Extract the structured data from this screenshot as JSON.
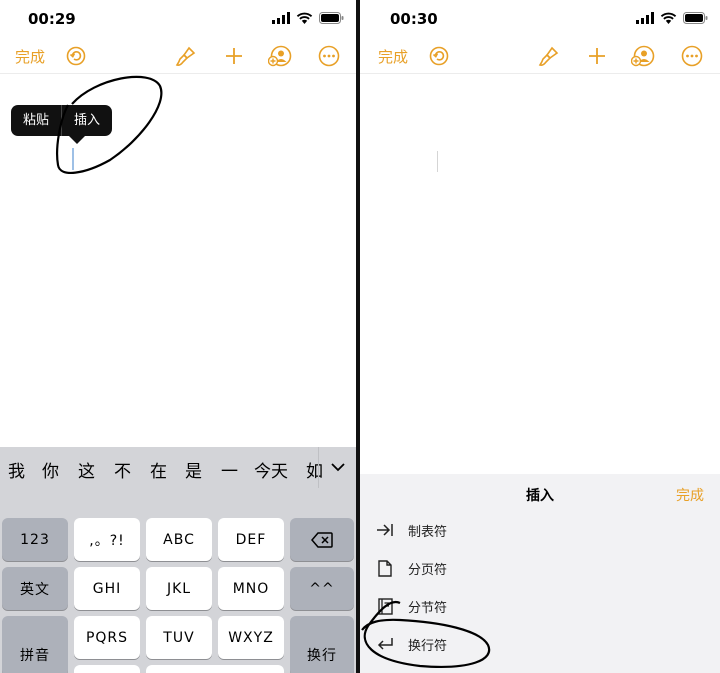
{
  "left": {
    "status": {
      "time": "00:29"
    },
    "toolbar": {
      "done_label": "完成"
    },
    "popup": {
      "paste_label": "粘贴",
      "insert_label": "插入"
    },
    "keyboard": {
      "candidates": [
        "我",
        "你",
        "这",
        "不",
        "在",
        "是",
        "一",
        "今天",
        "如"
      ],
      "keys": {
        "num": "123",
        "punct": ",。?!",
        "abc": "ABC",
        "def": "DEF",
        "eng": "英文",
        "ghi": "GHI",
        "jkl": "JKL",
        "mno": "MNO",
        "face": "^^",
        "pinyin": "拼音",
        "pqrs": "PQRS",
        "tuv": "TUV",
        "wxyz": "WXYZ",
        "enter": "换行"
      }
    }
  },
  "right": {
    "status": {
      "time": "00:30"
    },
    "toolbar": {
      "done_label": "完成"
    },
    "sheet": {
      "title": "插入",
      "done_label": "完成",
      "items": [
        {
          "label": "制表符",
          "icon": "tab-icon"
        },
        {
          "label": "分页符",
          "icon": "page-break-icon"
        },
        {
          "label": "分节符",
          "icon": "section-break-icon"
        },
        {
          "label": "换行符",
          "icon": "line-break-icon"
        }
      ]
    }
  },
  "colors": {
    "accent": "#e8a027",
    "keyboard_bg": "#d3d4d8",
    "popup_bg": "#111111"
  }
}
